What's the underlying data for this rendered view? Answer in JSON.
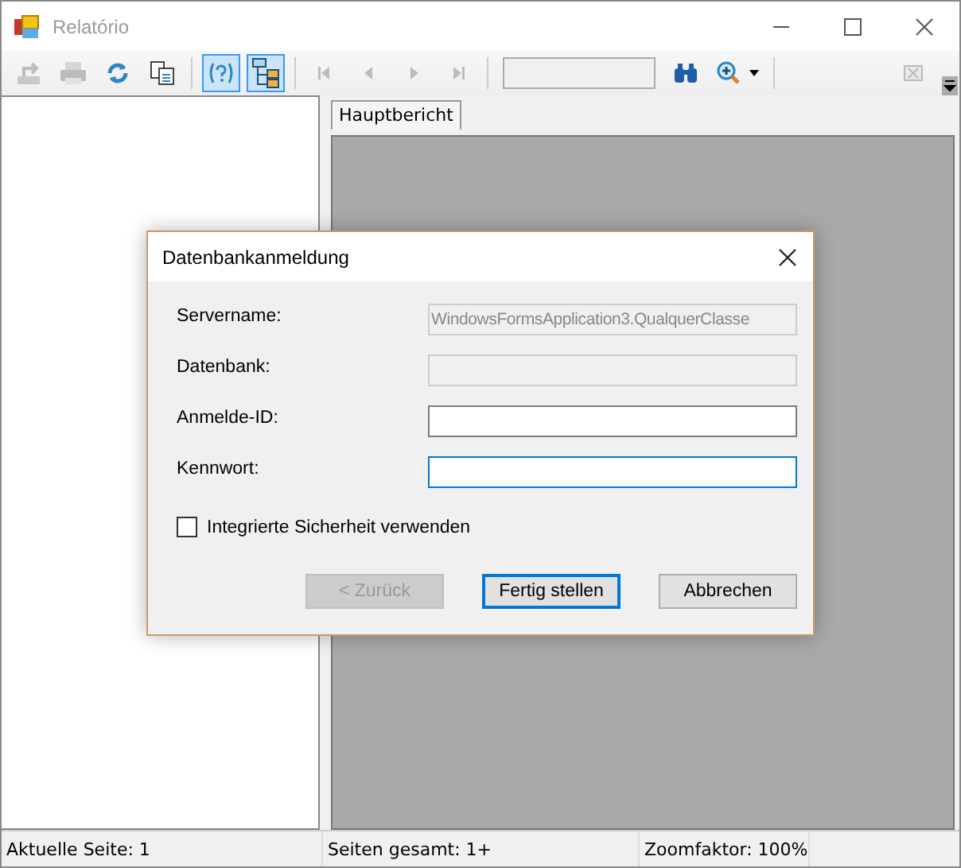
{
  "window": {
    "title": "Relatório"
  },
  "toolbar": [
    {
      "kind": "export",
      "disabled": true,
      "pressed": false
    },
    {
      "kind": "print",
      "disabled": true,
      "pressed": false
    },
    {
      "kind": "refresh",
      "disabled": false,
      "pressed": false
    },
    {
      "kind": "copy",
      "disabled": false,
      "pressed": false
    },
    {
      "kind": "separator"
    },
    {
      "kind": "help",
      "disabled": false,
      "pressed": true
    },
    {
      "kind": "tree",
      "disabled": false,
      "pressed": true
    },
    {
      "kind": "separator"
    },
    {
      "kind": "first",
      "disabled": true,
      "pressed": false
    },
    {
      "kind": "prev",
      "disabled": true,
      "pressed": false
    },
    {
      "kind": "next",
      "disabled": true,
      "pressed": false
    },
    {
      "kind": "last",
      "disabled": true,
      "pressed": false
    },
    {
      "kind": "separator"
    },
    {
      "kind": "pagefield"
    },
    {
      "kind": "find",
      "disabled": false,
      "pressed": false
    },
    {
      "kind": "zoom",
      "disabled": false,
      "pressed": false
    },
    {
      "kind": "separator"
    }
  ],
  "tabs": [
    {
      "label": "Hauptbericht",
      "selected": true
    }
  ],
  "status_bar": [
    "Aktuelle Seite: 1",
    "Seiten gesamt: 1+",
    "Zoomfaktor: 100%"
  ],
  "dialog": {
    "title": "Datenbankanmeldung",
    "fields": [
      {
        "label": "Servername:",
        "value": "WindowsFormsApplication3.QualquerClasse",
        "disabled": true,
        "focused": false
      },
      {
        "label": "Datenbank:",
        "disabled": true,
        "focused": false
      },
      {
        "label": "Anmelde-ID:",
        "disabled": false,
        "focused": false
      },
      {
        "label": "Kennwort:",
        "disabled": false,
        "focused": true
      }
    ],
    "checkbox": {
      "label": "Integrierte Sicherheit verwenden",
      "checked": false
    },
    "buttons": [
      {
        "label": "< Zurück",
        "disabled": true,
        "default": false
      },
      {
        "label": "Fertig stellen",
        "disabled": false,
        "default": true
      },
      {
        "label": "Abbrechen",
        "disabled": false,
        "default": false
      }
    ]
  }
}
